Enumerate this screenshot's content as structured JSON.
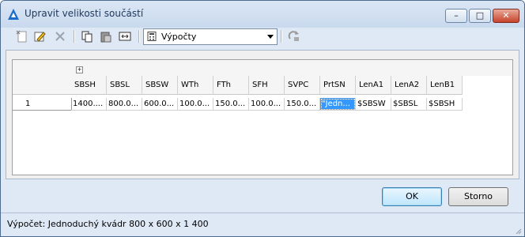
{
  "window": {
    "title": "Upravit velikosti součástí",
    "minimize": "–",
    "maximize": "□",
    "close": "✕"
  },
  "toolbar": {
    "icons": [
      "new-icon",
      "edit-icon",
      "delete-icon",
      "copy-icon",
      "paste-icon",
      "insert-column-icon",
      "refresh-icon"
    ],
    "combo_value": "Výpočty"
  },
  "table": {
    "columns": [
      "SBSH",
      "SBSL",
      "SBSW",
      "WTh",
      "FTh",
      "SFH",
      "SVPC",
      "PrtSN",
      "LenA1",
      "LenA2",
      "LenB1"
    ],
    "rows": [
      {
        "index": "1",
        "cells": [
          "1400....",
          "800.0...",
          "600.0...",
          "100.0...",
          "150.0...",
          "100.0...",
          "150.0...",
          "\"Jedn...",
          "$SBSW",
          "$SBSL",
          "$SBSH"
        ]
      }
    ],
    "selected_column": "PrtSN"
  },
  "buttons": {
    "ok": "OK",
    "cancel": "Storno"
  },
  "status": {
    "text": "Výpočet: Jednoduchý kvádr 800 x 600 x 1 400"
  }
}
